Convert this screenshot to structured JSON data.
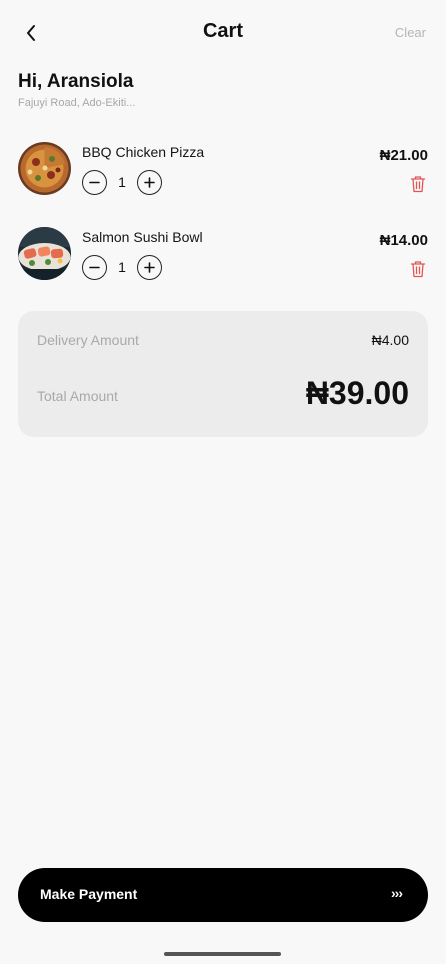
{
  "header": {
    "title": "Cart",
    "clear_label": "Clear",
    "back_icon": "chevron-left-icon"
  },
  "user": {
    "greeting": "Hi, Aransiola",
    "address": "Fajuyi Road, Ado-Ekiti..."
  },
  "cart": {
    "items": [
      {
        "name": "BBQ Chicken Pizza",
        "quantity": "1",
        "price": "₦21.00",
        "image": "pizza-thumbnail"
      },
      {
        "name": "Salmon Sushi Bowl",
        "quantity": "1",
        "price": "₦14.00",
        "image": "sushi-thumbnail"
      }
    ]
  },
  "summary": {
    "delivery_label": "Delivery Amount",
    "delivery_value": "₦4.00",
    "total_label": "Total Amount",
    "total_value": "₦39.00"
  },
  "payment": {
    "button_label": "Make Payment",
    "arrows": "›››"
  },
  "colors": {
    "accent": "#000000",
    "delete": "#e35454",
    "background": "#f8f8f8",
    "summary_bg": "#ececec"
  }
}
